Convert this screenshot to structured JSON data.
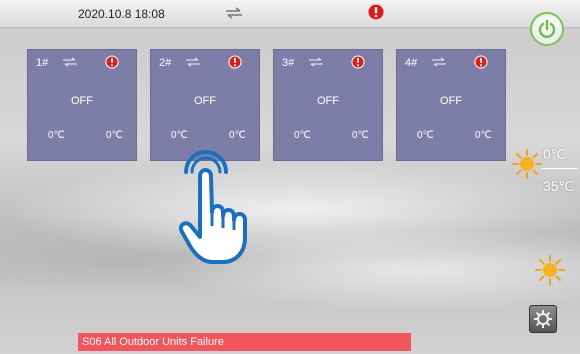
{
  "header": {
    "datetime": "2020.10.8 18:08"
  },
  "units": [
    {
      "name": "1#",
      "status": "OFF",
      "temp_left": "0℃",
      "temp_right": "0℃"
    },
    {
      "name": "2#",
      "status": "OFF",
      "temp_left": "0℃",
      "temp_right": "0℃"
    },
    {
      "name": "3#",
      "status": "OFF",
      "temp_left": "0℃",
      "temp_right": "0℃"
    },
    {
      "name": "4#",
      "status": "OFF",
      "temp_left": "0℃",
      "temp_right": "0℃"
    }
  ],
  "side": {
    "temp_current": "0℃",
    "temp_set": "35℃"
  },
  "alarm": {
    "message": "S06 All Outdoor Units Failure"
  },
  "colors": {
    "card": "#7d7ea8",
    "alarm_red": "#e21b1b",
    "power_green": "#7bc25b",
    "alarm_bar": "#f2555c",
    "hand_blue": "#1a6fc2"
  },
  "icons": [
    "swap-arrows-icon",
    "alarm-exclamation-icon",
    "power-icon",
    "sun-icon",
    "settings-gear-icon",
    "touch-hand-icon"
  ]
}
